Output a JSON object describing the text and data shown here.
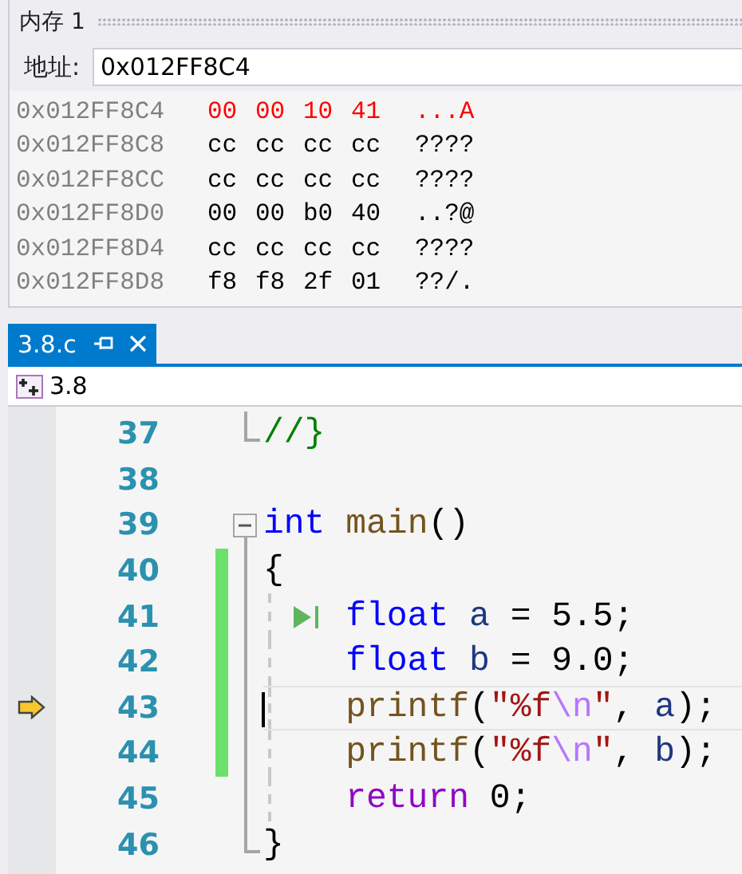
{
  "memory": {
    "title": "内存 1",
    "address_label": "地址:",
    "address": "0x012FF8C4",
    "rows": [
      {
        "address": "0x012FF8C4",
        "bytes": [
          "00",
          "00",
          "10",
          "41"
        ],
        "ascii": "...A",
        "changed": true
      },
      {
        "address": "0x012FF8C8",
        "bytes": [
          "cc",
          "cc",
          "cc",
          "cc"
        ],
        "ascii": "????",
        "changed": false
      },
      {
        "address": "0x012FF8CC",
        "bytes": [
          "cc",
          "cc",
          "cc",
          "cc"
        ],
        "ascii": "????",
        "changed": false
      },
      {
        "address": "0x012FF8D0",
        "bytes": [
          "00",
          "00",
          "b0",
          "40"
        ],
        "ascii": "..?@",
        "changed": false
      },
      {
        "address": "0x012FF8D4",
        "bytes": [
          "cc",
          "cc",
          "cc",
          "cc"
        ],
        "ascii": "????",
        "changed": false
      },
      {
        "address": "0x012FF8D8",
        "bytes": [
          "f8",
          "f8",
          "2f",
          "01"
        ],
        "ascii": "??/.",
        "changed": false
      }
    ]
  },
  "tabs": [
    {
      "label": "3.8.c",
      "selected": true
    }
  ],
  "navigation": {
    "scope": "3.8"
  },
  "lines": [
    {
      "number": "37",
      "kind": "foldend",
      "indented": false,
      "changed": false,
      "current": false,
      "run_to_click": false,
      "tokens": [
        {
          "text": "//}",
          "kind": "comment"
        }
      ]
    },
    {
      "number": "38",
      "kind": "plain",
      "indented": false,
      "changed": false,
      "current": false,
      "run_to_click": false
    },
    {
      "number": "39",
      "kind": "foldstart",
      "indented": false,
      "changed": false,
      "current": false,
      "run_to_click": false,
      "tokens": [
        {
          "text": "int ",
          "kind": "keyword"
        },
        {
          "text": "main",
          "kind": "function"
        },
        {
          "text": "()",
          "kind": "plain"
        }
      ]
    },
    {
      "number": "40",
      "kind": "foldbody",
      "indented": false,
      "changed": true,
      "current": false,
      "run_to_click": false,
      "tokens": [
        {
          "text": "{",
          "kind": "plain"
        }
      ]
    },
    {
      "number": "41",
      "kind": "foldbody",
      "indented": true,
      "changed": true,
      "current": false,
      "run_to_click": true,
      "tokens": [
        {
          "text": "float ",
          "kind": "keyword"
        },
        {
          "text": "a",
          "kind": "variable"
        },
        {
          "text": " = 5.5;",
          "kind": "plain"
        }
      ]
    },
    {
      "number": "42",
      "kind": "foldbody",
      "indented": true,
      "changed": true,
      "current": false,
      "run_to_click": false,
      "tokens": [
        {
          "text": "float ",
          "kind": "keyword"
        },
        {
          "text": "b",
          "kind": "variable"
        },
        {
          "text": " = 9.0;",
          "kind": "plain"
        }
      ]
    },
    {
      "number": "43",
      "kind": "foldbody",
      "indented": true,
      "changed": true,
      "current": true,
      "run_to_click": false,
      "tokens": [
        {
          "text": "printf",
          "kind": "function"
        },
        {
          "text": "(",
          "kind": "plain"
        },
        {
          "text": "\"%f",
          "kind": "string"
        },
        {
          "text": "\\n",
          "kind": "escape"
        },
        {
          "text": "\"",
          "kind": "string"
        },
        {
          "text": ", ",
          "kind": "plain"
        },
        {
          "text": "a",
          "kind": "variable"
        },
        {
          "text": ");",
          "kind": "plain"
        }
      ]
    },
    {
      "number": "44",
      "kind": "foldbody",
      "indented": true,
      "changed": true,
      "current": false,
      "run_to_click": false,
      "tokens": [
        {
          "text": "printf",
          "kind": "function"
        },
        {
          "text": "(",
          "kind": "plain"
        },
        {
          "text": "\"%f",
          "kind": "string"
        },
        {
          "text": "\\n",
          "kind": "escape"
        },
        {
          "text": "\"",
          "kind": "string"
        },
        {
          "text": ", ",
          "kind": "plain"
        },
        {
          "text": "b",
          "kind": "variable"
        },
        {
          "text": ");",
          "kind": "plain"
        }
      ]
    },
    {
      "number": "45",
      "kind": "foldbody",
      "indented": true,
      "changed": false,
      "current": false,
      "run_to_click": false,
      "tokens": [
        {
          "text": "return",
          "kind": "control"
        },
        {
          "text": " 0;",
          "kind": "plain"
        }
      ]
    },
    {
      "number": "46",
      "kind": "foldend",
      "indented": false,
      "changed": false,
      "current": false,
      "run_to_click": false,
      "tokens": [
        {
          "text": "}",
          "kind": "plain"
        }
      ]
    }
  ]
}
